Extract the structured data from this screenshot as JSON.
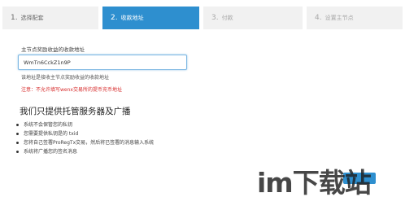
{
  "steps": [
    {
      "num": "1.",
      "label": "选择配套"
    },
    {
      "num": "2.",
      "label": "收款地址"
    },
    {
      "num": "3.",
      "label": "付款"
    },
    {
      "num": "4.",
      "label": "设置主节点"
    }
  ],
  "form": {
    "label": "主节点奖励收益的收款地址",
    "address_value": "WmTn6CckZ1n9P",
    "hint": "该地址是接收主节点奖励收益的收款地址",
    "warning": "注意：不允许填写wenx交易所的提币充币地址"
  },
  "info": {
    "heading": "我们只提供托管服务器及广播",
    "bullets": [
      "系统不会保管您的私钥",
      "您需要提供私钥是的 txid",
      "您将自己签署ProRegTx交易，然后将已签署的消息输入系统",
      "系统将广播您的签名消息"
    ]
  },
  "watermark": {
    "text": "im下载站"
  },
  "colors": {
    "accent": "#2e8fcf",
    "warning": "#d72b2b"
  }
}
